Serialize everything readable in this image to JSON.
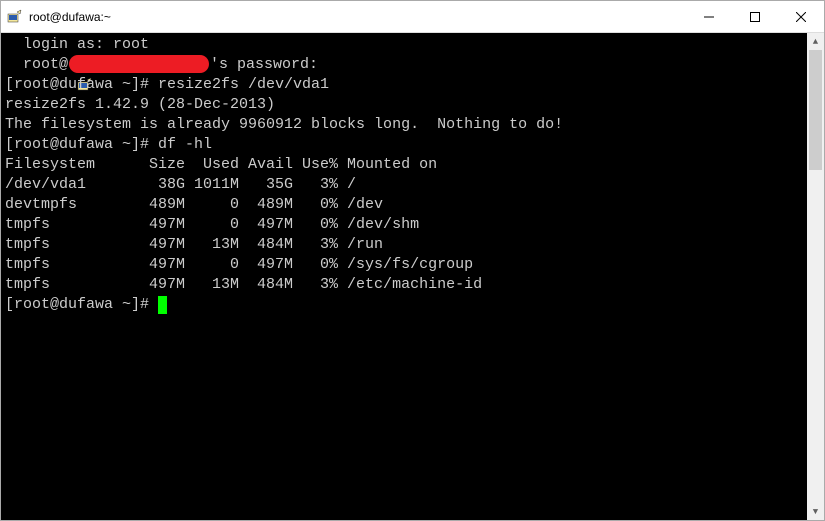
{
  "window": {
    "title": "root@dufawa:~"
  },
  "terminal": {
    "login_label": "login as: ",
    "login_user": "root",
    "passwd_prefix": "root@",
    "passwd_suffix": "'s password:",
    "prompt1": "[root@dufawa ~]# ",
    "cmd1": "resize2fs /dev/vda1",
    "out1": "resize2fs 1.42.9 (28-Dec-2013)",
    "out2": "The filesystem is already 9960912 blocks long.  Nothing to do!",
    "blank": "",
    "prompt2": "[root@dufawa ~]# ",
    "cmd2": "df -hl",
    "df_header": "Filesystem      Size  Used Avail Use% Mounted on",
    "df_rows": [
      "/dev/vda1        38G 1011M   35G   3% /",
      "devtmpfs        489M     0  489M   0% /dev",
      "tmpfs           497M     0  497M   0% /dev/shm",
      "tmpfs           497M   13M  484M   3% /run",
      "tmpfs           497M     0  497M   0% /sys/fs/cgroup",
      "tmpfs           497M   13M  484M   3% /etc/machine-id"
    ],
    "prompt3": "[root@dufawa ~]# "
  }
}
